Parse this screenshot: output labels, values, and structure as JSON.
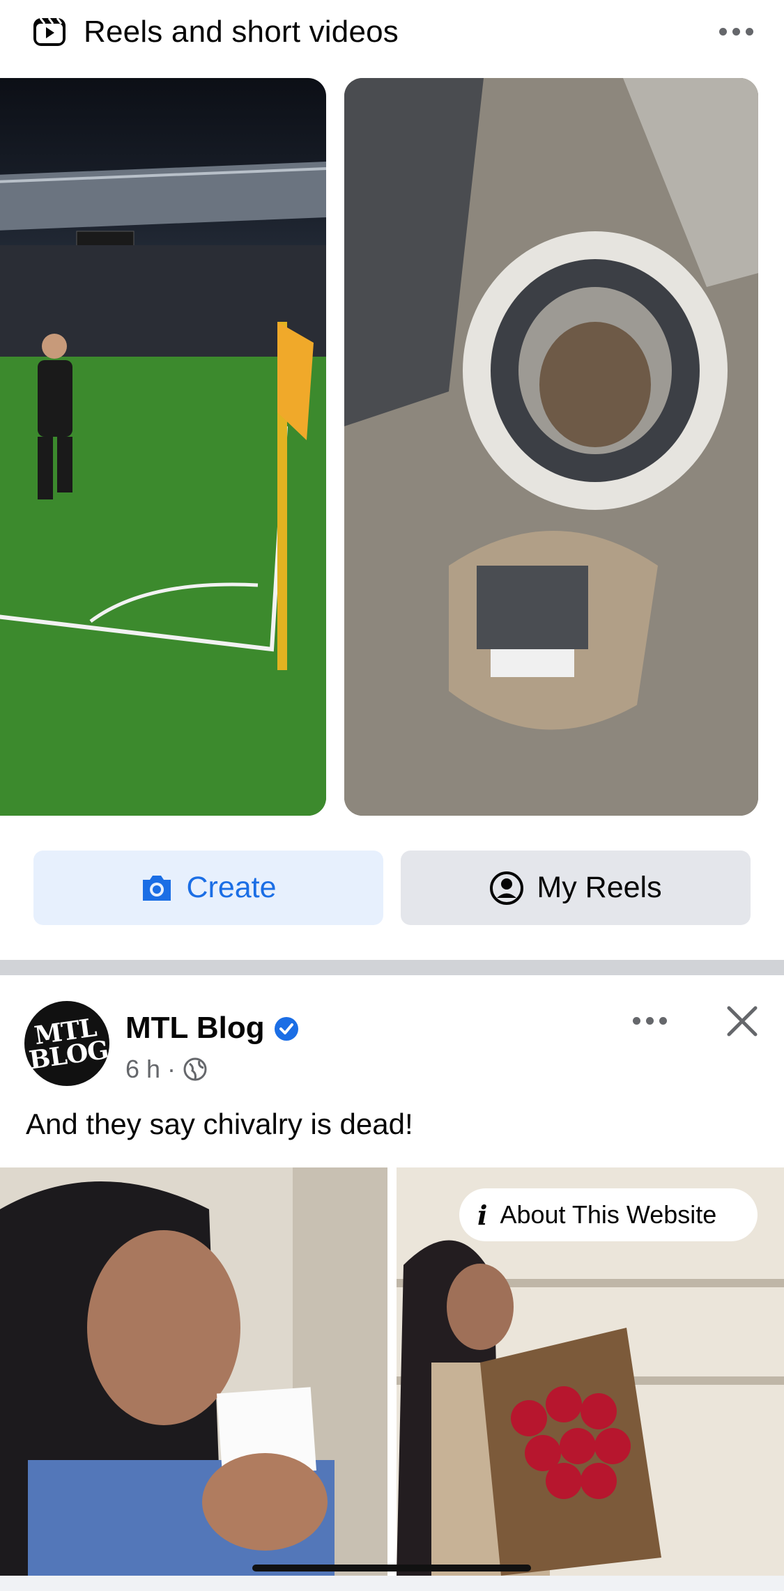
{
  "reels": {
    "title": "Reels and short videos",
    "create_label": "Create",
    "my_reels_label": "My Reels"
  },
  "post": {
    "page_name": "MTL Blog",
    "avatar_text": "MTL BLOG",
    "time": "6 h",
    "separator": "·",
    "text": "And they say chivalry is dead!",
    "about_website_label": "About This Website",
    "info_glyph": "i"
  },
  "icons": [
    "reels-icon",
    "more-icon",
    "camera-icon",
    "profile-icon",
    "verified-icon",
    "globe-icon",
    "close-icon",
    "info-icon"
  ],
  "colors": {
    "accent": "#1b6ee5",
    "create_bg": "#e7f0fd",
    "secondary_bg": "#e4e6eb",
    "meta_gray": "#65676b"
  }
}
